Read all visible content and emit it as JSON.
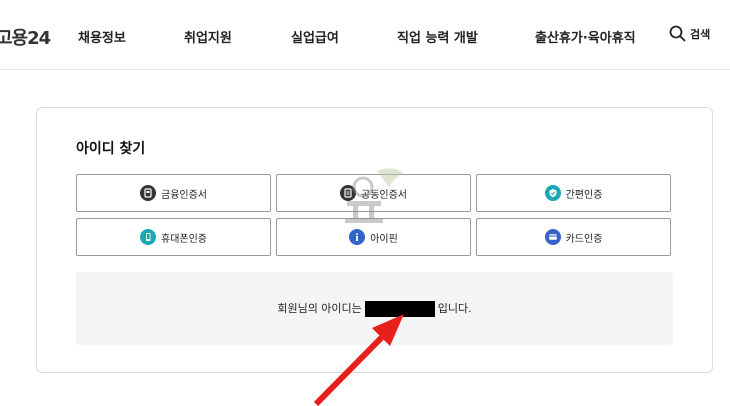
{
  "header": {
    "logo": "고용24",
    "nav": [
      "채용정보",
      "취업지원",
      "실업급여",
      "직업 능력 개발",
      "출산휴가·육아휴직"
    ],
    "search_label": "검색"
  },
  "card": {
    "title": "아이디 찾기",
    "auth_buttons": [
      {
        "label": "금융인증서",
        "icon": "financial-cert-icon",
        "color": "#333333"
      },
      {
        "label": "공동인증서",
        "icon": "joint-cert-icon",
        "color": "#333333"
      },
      {
        "label": "간편인증",
        "icon": "shield-check-icon",
        "color": "#1aa7b5"
      },
      {
        "label": "휴대폰인증",
        "icon": "phone-icon",
        "color": "#1aa7b5"
      },
      {
        "label": "아이핀",
        "icon": "info-icon",
        "color": "#2f64c8"
      },
      {
        "label": "카드인증",
        "icon": "card-icon",
        "color": "#3a63c9"
      }
    ],
    "result": {
      "prefix": "회원님의 아이디는",
      "suffix": "입니다."
    }
  },
  "colors": {
    "arrow": "#e8201c",
    "border": "#9a9a9a",
    "result_bg": "#f5f5f5"
  }
}
